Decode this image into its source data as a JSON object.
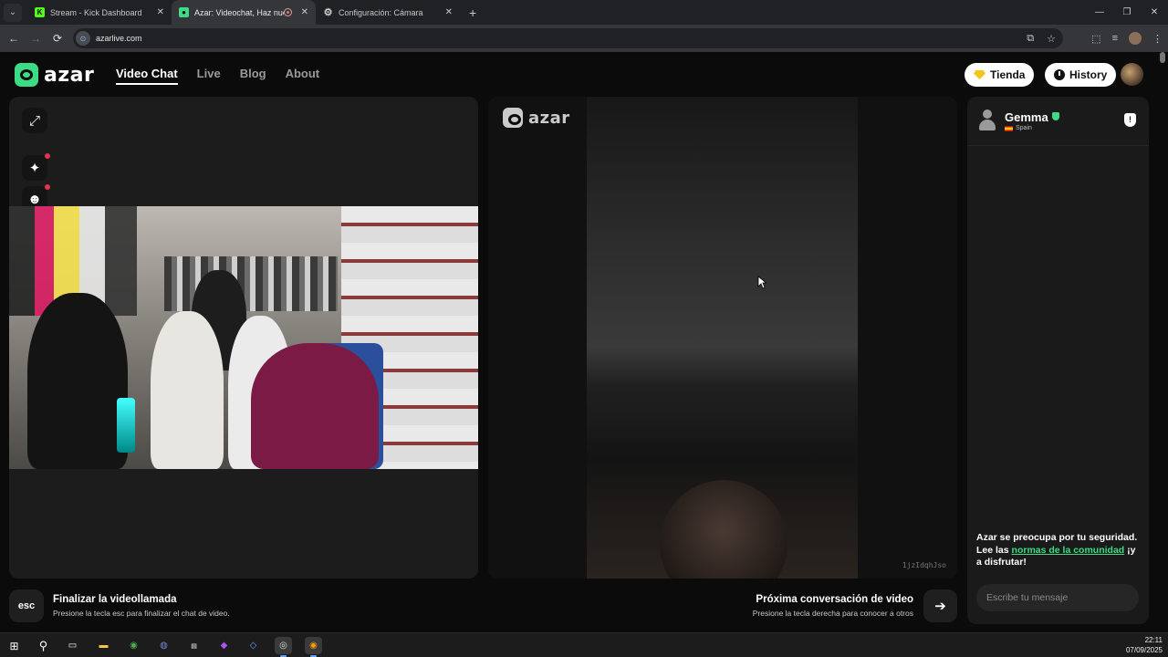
{
  "browser": {
    "tabs": [
      {
        "title": "Stream - Kick Dashboard",
        "active": false
      },
      {
        "title": "Azar: Videochat, Haz nuevo",
        "active": true
      },
      {
        "title": "Configuración: Cámara",
        "active": false
      }
    ],
    "url": "azarlive.com"
  },
  "header": {
    "logo_text": "azar",
    "nav": [
      "Video Chat",
      "Live",
      "Blog",
      "About"
    ],
    "active_nav": "Video Chat",
    "store_label": "Tienda",
    "history_label": "History"
  },
  "partner_video": {
    "watermark_logo": "azar",
    "watermark_id": "1jzIdqhJso"
  },
  "chat": {
    "partner_name": "Gemma",
    "partner_country": "Spain",
    "safety_prefix": "Azar se preocupa por tu seguridad. Lee las ",
    "safety_link": "normas de la comunidad",
    "safety_suffix": " ¡y a disfrutar!",
    "input_placeholder": "Escribe tu mensaje"
  },
  "actions": {
    "esc_label": "esc",
    "end_title": "Finalizar la videollamada",
    "end_subtitle": "Presione la tecla esc para finalizar el chat de video.",
    "next_title": "Próxima conversación de video",
    "next_subtitle": "Presione la tecla derecha para conocer a otros"
  },
  "taskbar": {
    "time": "22:11",
    "date": "07/09/2025"
  },
  "colors": {
    "brand_green": "#3ddc84",
    "notification_red": "#e2344c",
    "store_gem": "#f5c518"
  }
}
